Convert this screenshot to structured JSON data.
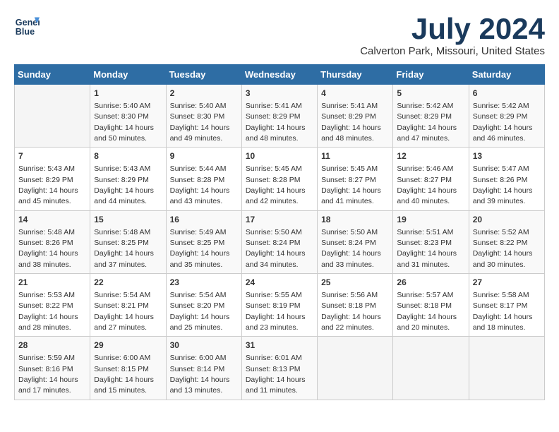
{
  "header": {
    "logo_line1": "General",
    "logo_line2": "Blue",
    "title": "July 2024",
    "location": "Calverton Park, Missouri, United States"
  },
  "weekdays": [
    "Sunday",
    "Monday",
    "Tuesday",
    "Wednesday",
    "Thursday",
    "Friday",
    "Saturday"
  ],
  "weeks": [
    [
      {
        "day": "",
        "sunrise": "",
        "sunset": "",
        "daylight": ""
      },
      {
        "day": "1",
        "sunrise": "Sunrise: 5:40 AM",
        "sunset": "Sunset: 8:30 PM",
        "daylight": "Daylight: 14 hours and 50 minutes."
      },
      {
        "day": "2",
        "sunrise": "Sunrise: 5:40 AM",
        "sunset": "Sunset: 8:30 PM",
        "daylight": "Daylight: 14 hours and 49 minutes."
      },
      {
        "day": "3",
        "sunrise": "Sunrise: 5:41 AM",
        "sunset": "Sunset: 8:29 PM",
        "daylight": "Daylight: 14 hours and 48 minutes."
      },
      {
        "day": "4",
        "sunrise": "Sunrise: 5:41 AM",
        "sunset": "Sunset: 8:29 PM",
        "daylight": "Daylight: 14 hours and 48 minutes."
      },
      {
        "day": "5",
        "sunrise": "Sunrise: 5:42 AM",
        "sunset": "Sunset: 8:29 PM",
        "daylight": "Daylight: 14 hours and 47 minutes."
      },
      {
        "day": "6",
        "sunrise": "Sunrise: 5:42 AM",
        "sunset": "Sunset: 8:29 PM",
        "daylight": "Daylight: 14 hours and 46 minutes."
      }
    ],
    [
      {
        "day": "7",
        "sunrise": "Sunrise: 5:43 AM",
        "sunset": "Sunset: 8:29 PM",
        "daylight": "Daylight: 14 hours and 45 minutes."
      },
      {
        "day": "8",
        "sunrise": "Sunrise: 5:43 AM",
        "sunset": "Sunset: 8:29 PM",
        "daylight": "Daylight: 14 hours and 44 minutes."
      },
      {
        "day": "9",
        "sunrise": "Sunrise: 5:44 AM",
        "sunset": "Sunset: 8:28 PM",
        "daylight": "Daylight: 14 hours and 43 minutes."
      },
      {
        "day": "10",
        "sunrise": "Sunrise: 5:45 AM",
        "sunset": "Sunset: 8:28 PM",
        "daylight": "Daylight: 14 hours and 42 minutes."
      },
      {
        "day": "11",
        "sunrise": "Sunrise: 5:45 AM",
        "sunset": "Sunset: 8:27 PM",
        "daylight": "Daylight: 14 hours and 41 minutes."
      },
      {
        "day": "12",
        "sunrise": "Sunrise: 5:46 AM",
        "sunset": "Sunset: 8:27 PM",
        "daylight": "Daylight: 14 hours and 40 minutes."
      },
      {
        "day": "13",
        "sunrise": "Sunrise: 5:47 AM",
        "sunset": "Sunset: 8:26 PM",
        "daylight": "Daylight: 14 hours and 39 minutes."
      }
    ],
    [
      {
        "day": "14",
        "sunrise": "Sunrise: 5:48 AM",
        "sunset": "Sunset: 8:26 PM",
        "daylight": "Daylight: 14 hours and 38 minutes."
      },
      {
        "day": "15",
        "sunrise": "Sunrise: 5:48 AM",
        "sunset": "Sunset: 8:25 PM",
        "daylight": "Daylight: 14 hours and 37 minutes."
      },
      {
        "day": "16",
        "sunrise": "Sunrise: 5:49 AM",
        "sunset": "Sunset: 8:25 PM",
        "daylight": "Daylight: 14 hours and 35 minutes."
      },
      {
        "day": "17",
        "sunrise": "Sunrise: 5:50 AM",
        "sunset": "Sunset: 8:24 PM",
        "daylight": "Daylight: 14 hours and 34 minutes."
      },
      {
        "day": "18",
        "sunrise": "Sunrise: 5:50 AM",
        "sunset": "Sunset: 8:24 PM",
        "daylight": "Daylight: 14 hours and 33 minutes."
      },
      {
        "day": "19",
        "sunrise": "Sunrise: 5:51 AM",
        "sunset": "Sunset: 8:23 PM",
        "daylight": "Daylight: 14 hours and 31 minutes."
      },
      {
        "day": "20",
        "sunrise": "Sunrise: 5:52 AM",
        "sunset": "Sunset: 8:22 PM",
        "daylight": "Daylight: 14 hours and 30 minutes."
      }
    ],
    [
      {
        "day": "21",
        "sunrise": "Sunrise: 5:53 AM",
        "sunset": "Sunset: 8:22 PM",
        "daylight": "Daylight: 14 hours and 28 minutes."
      },
      {
        "day": "22",
        "sunrise": "Sunrise: 5:54 AM",
        "sunset": "Sunset: 8:21 PM",
        "daylight": "Daylight: 14 hours and 27 minutes."
      },
      {
        "day": "23",
        "sunrise": "Sunrise: 5:54 AM",
        "sunset": "Sunset: 8:20 PM",
        "daylight": "Daylight: 14 hours and 25 minutes."
      },
      {
        "day": "24",
        "sunrise": "Sunrise: 5:55 AM",
        "sunset": "Sunset: 8:19 PM",
        "daylight": "Daylight: 14 hours and 23 minutes."
      },
      {
        "day": "25",
        "sunrise": "Sunrise: 5:56 AM",
        "sunset": "Sunset: 8:18 PM",
        "daylight": "Daylight: 14 hours and 22 minutes."
      },
      {
        "day": "26",
        "sunrise": "Sunrise: 5:57 AM",
        "sunset": "Sunset: 8:18 PM",
        "daylight": "Daylight: 14 hours and 20 minutes."
      },
      {
        "day": "27",
        "sunrise": "Sunrise: 5:58 AM",
        "sunset": "Sunset: 8:17 PM",
        "daylight": "Daylight: 14 hours and 18 minutes."
      }
    ],
    [
      {
        "day": "28",
        "sunrise": "Sunrise: 5:59 AM",
        "sunset": "Sunset: 8:16 PM",
        "daylight": "Daylight: 14 hours and 17 minutes."
      },
      {
        "day": "29",
        "sunrise": "Sunrise: 6:00 AM",
        "sunset": "Sunset: 8:15 PM",
        "daylight": "Daylight: 14 hours and 15 minutes."
      },
      {
        "day": "30",
        "sunrise": "Sunrise: 6:00 AM",
        "sunset": "Sunset: 8:14 PM",
        "daylight": "Daylight: 14 hours and 13 minutes."
      },
      {
        "day": "31",
        "sunrise": "Sunrise: 6:01 AM",
        "sunset": "Sunset: 8:13 PM",
        "daylight": "Daylight: 14 hours and 11 minutes."
      },
      {
        "day": "",
        "sunrise": "",
        "sunset": "",
        "daylight": ""
      },
      {
        "day": "",
        "sunrise": "",
        "sunset": "",
        "daylight": ""
      },
      {
        "day": "",
        "sunrise": "",
        "sunset": "",
        "daylight": ""
      }
    ]
  ]
}
